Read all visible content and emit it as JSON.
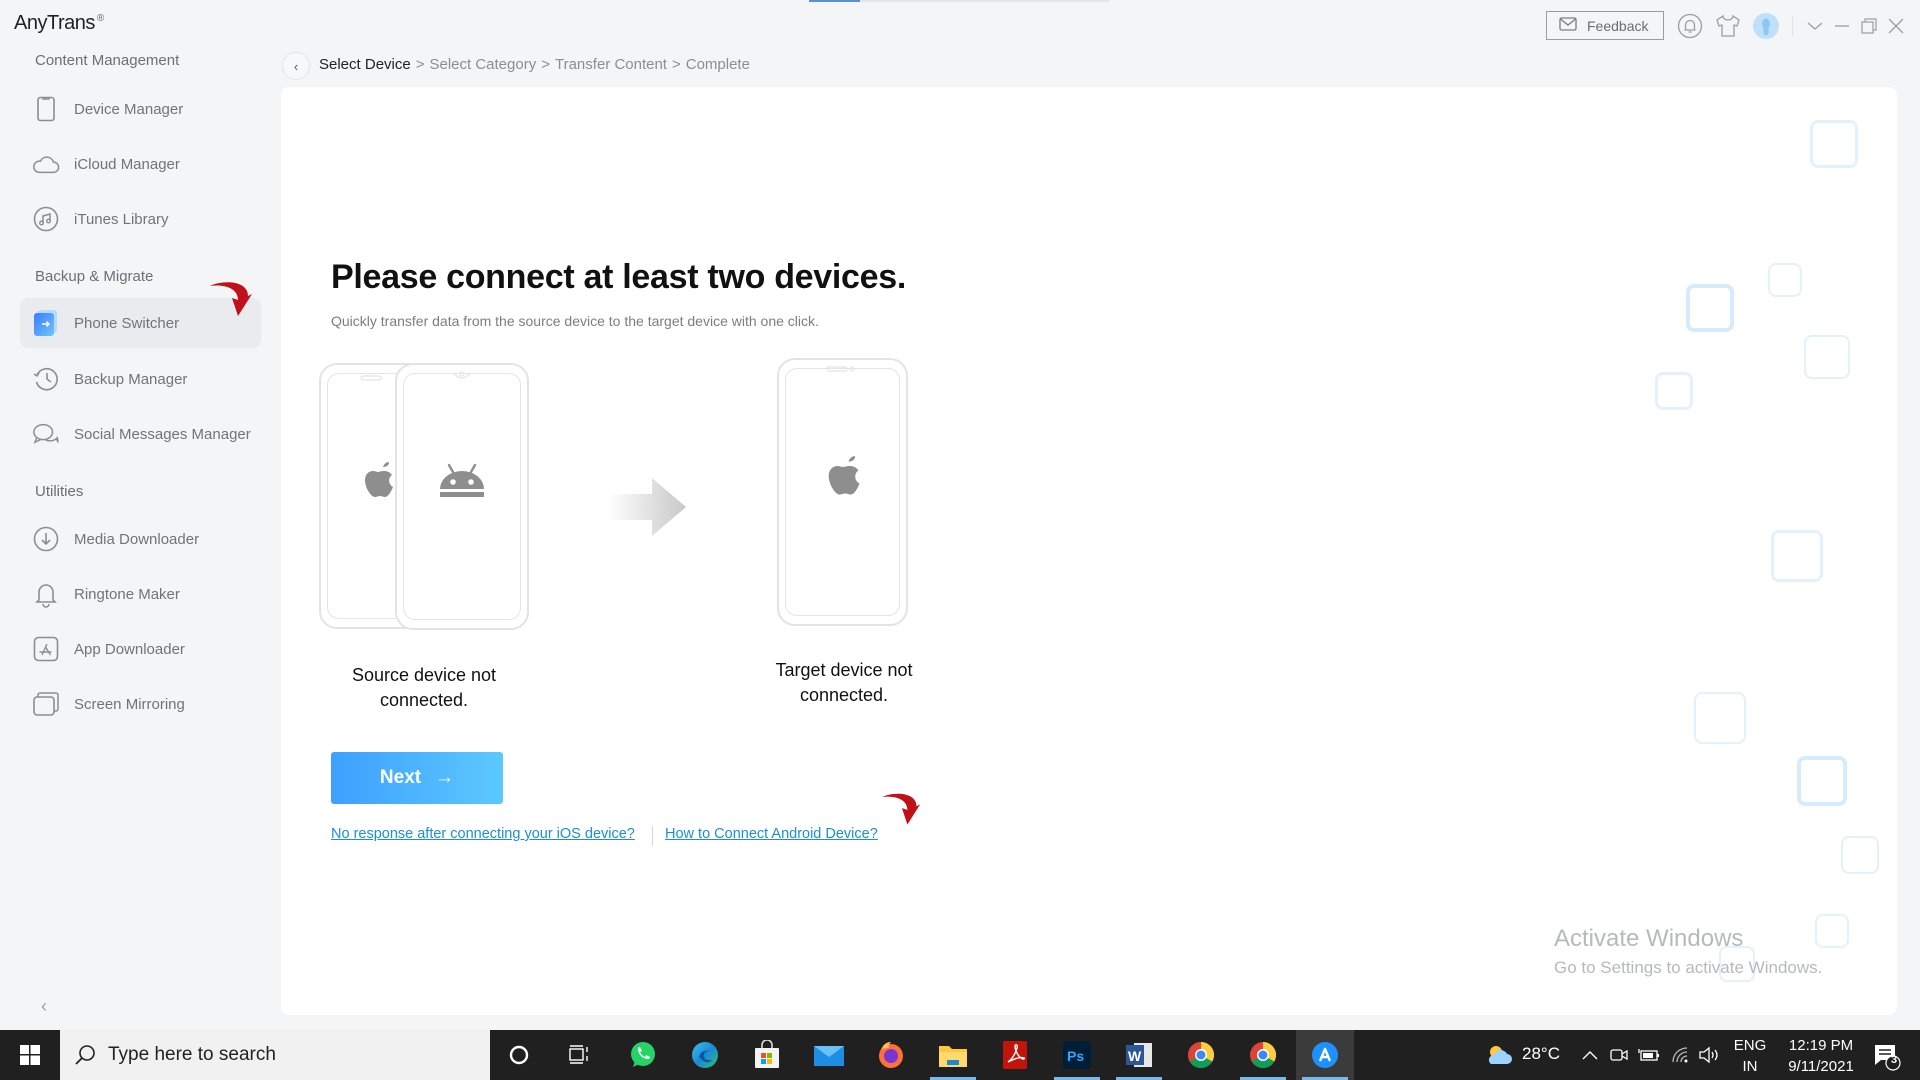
{
  "app": {
    "name": "AnyTrans",
    "trademark": "®",
    "progress_fraction": 0.17
  },
  "header": {
    "feedback_label": "Feedback",
    "icons": [
      "notification-bell-icon",
      "skin-shirt-icon",
      "user-avatar-icon"
    ],
    "window_controls": [
      "dropdown",
      "minimize",
      "restore",
      "close"
    ]
  },
  "sidebar": {
    "sections": [
      {
        "title": "Content Management",
        "items": [
          {
            "label": "Device Manager",
            "icon": "phone-outline-icon"
          },
          {
            "label": "iCloud Manager",
            "icon": "cloud-icon"
          },
          {
            "label": "iTunes Library",
            "icon": "music-note-icon"
          }
        ]
      },
      {
        "title": "Backup & Migrate",
        "items": [
          {
            "label": "Phone Switcher",
            "icon": "phone-switcher-icon",
            "active": true
          },
          {
            "label": "Backup Manager",
            "icon": "history-clock-icon"
          },
          {
            "label": "Social Messages Manager",
            "icon": "chat-bubbles-icon"
          }
        ]
      },
      {
        "title": "Utilities",
        "items": [
          {
            "label": "Media Downloader",
            "icon": "download-circle-icon"
          },
          {
            "label": "Ringtone Maker",
            "icon": "bell-icon"
          },
          {
            "label": "App Downloader",
            "icon": "app-store-icon"
          },
          {
            "label": "Screen Mirroring",
            "icon": "screen-mirror-icon"
          }
        ]
      }
    ],
    "collapse_glyph": "‹"
  },
  "breadcrumb": {
    "back_glyph": "‹",
    "steps": [
      "Select Device",
      "Select Category",
      "Transfer Content",
      "Complete"
    ],
    "separator": ">",
    "current_index": 0
  },
  "main": {
    "title": "Please connect at least two devices.",
    "subtitle": "Quickly transfer data from the source device to the target device with one click.",
    "source": {
      "label_line1": "Source device not",
      "label_line2": "connected.",
      "platforms": [
        "iOS",
        "Android"
      ]
    },
    "target": {
      "label_line1": "Target device not",
      "label_line2": "connected.",
      "platforms": [
        "iOS"
      ]
    },
    "next_label": "Next",
    "next_arrow": "→",
    "links": [
      "No response after connecting your iOS device?",
      "How to Connect Android Device?"
    ]
  },
  "watermark": {
    "line1": "Activate Windows",
    "line2": "Go to Settings to activate Windows."
  },
  "taskbar": {
    "search_placeholder": "Type here to search",
    "apps": [
      {
        "name": "cortana",
        "running": false
      },
      {
        "name": "task-view",
        "running": false
      },
      {
        "name": "whatsapp",
        "running": false
      },
      {
        "name": "edge",
        "running": false
      },
      {
        "name": "microsoft-store",
        "running": false
      },
      {
        "name": "mail",
        "running": false
      },
      {
        "name": "firefox",
        "running": false
      },
      {
        "name": "file-explorer",
        "running": true
      },
      {
        "name": "acrobat",
        "running": false
      },
      {
        "name": "photoshop",
        "running": true
      },
      {
        "name": "word",
        "running": true
      },
      {
        "name": "chrome",
        "running": false
      },
      {
        "name": "chrome-2",
        "running": true
      },
      {
        "name": "anytrans",
        "running": true,
        "active": true
      }
    ],
    "weather": "28°C",
    "language_line1": "ENG",
    "language_line2": "IN",
    "time": "12:19 PM",
    "date": "9/11/2021",
    "notification_count": "3"
  },
  "colors": {
    "accent": "#3da0ff",
    "accent_end": "#5cc8ff",
    "link": "#1c8ed8",
    "annotation_arrow": "#c0111b",
    "taskbar_bg": "#202020"
  }
}
